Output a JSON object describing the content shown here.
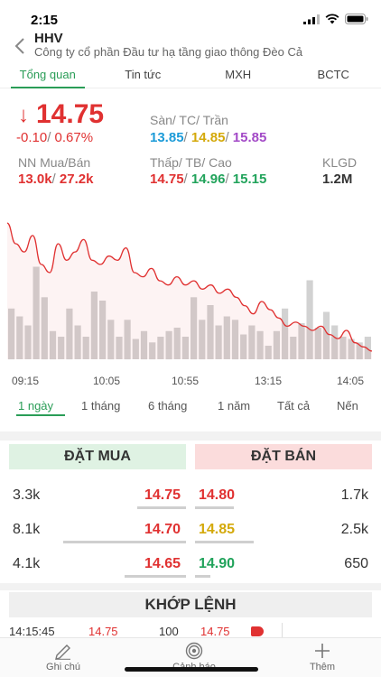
{
  "status_bar": {
    "time": "2:15"
  },
  "header": {
    "ticker": "HHV",
    "company": "Công ty cổ phần Đầu tư hạ tầng giao thông Đèo Cả"
  },
  "tabs": [
    {
      "label": "Tổng quan",
      "active": true
    },
    {
      "label": "Tin tức",
      "active": false
    },
    {
      "label": "MXH",
      "active": false
    },
    {
      "label": "BCTC",
      "active": false
    }
  ],
  "quote": {
    "price": "14.75",
    "change": "-0.10",
    "change_pct": "0.67%",
    "floor_ref_ceil_label": "Sàn/ TC/ Trần",
    "floor": "13.85",
    "ref": "14.85",
    "ceil": "15.85",
    "foreign_label": "NN Mua/Bán",
    "foreign_buy": "13.0k",
    "foreign_sell": "27.2k",
    "low_avg_high_label": "Thấp/ TB/ Cao",
    "low": "14.75",
    "avg": "14.96",
    "high": "15.15",
    "volume_label": "KLGD",
    "volume": "1.2M"
  },
  "chart_data": {
    "type": "line",
    "x_ticks": [
      "09:15",
      "10:05",
      "10:55",
      "13:15",
      "14:05"
    ],
    "price_line": [
      15.05,
      15.0,
      14.98,
      15.02,
      14.95,
      14.93,
      15.0,
      14.96,
      14.98,
      15.01,
      14.96,
      14.95,
      14.97,
      14.96,
      14.99,
      14.93,
      14.92,
      14.94,
      14.91,
      14.9,
      14.92,
      14.9,
      14.91,
      14.89,
      14.9,
      14.88,
      14.89,
      14.87,
      14.85,
      14.83,
      14.86,
      14.84,
      14.82,
      14.8,
      14.81,
      14.8,
      14.79,
      14.8,
      14.78,
      14.77,
      14.79,
      14.76,
      14.75,
      14.74
    ],
    "volume_bars": [
      0.45,
      0.38,
      0.3,
      0.82,
      0.55,
      0.25,
      0.2,
      0.45,
      0.3,
      0.2,
      0.6,
      0.52,
      0.35,
      0.2,
      0.35,
      0.18,
      0.25,
      0.15,
      0.2,
      0.25,
      0.28,
      0.2,
      0.55,
      0.35,
      0.48,
      0.3,
      0.38,
      0.35,
      0.22,
      0.3,
      0.25,
      0.12,
      0.25,
      0.45,
      0.2,
      0.32,
      0.7,
      0.28,
      0.42,
      0.3,
      0.2,
      0.18,
      0.15,
      0.2
    ],
    "grid": false
  },
  "ranges": [
    {
      "label": "1 ngày",
      "active": true
    },
    {
      "label": "1 tháng",
      "active": false
    },
    {
      "label": "6 tháng",
      "active": false
    },
    {
      "label": "1 năm",
      "active": false
    },
    {
      "label": "Tất cả",
      "active": false
    },
    {
      "label": "Nến",
      "active": false
    }
  ],
  "order_book": {
    "buy_label": "ĐẶT MUA",
    "sell_label": "ĐẶT BÁN",
    "rows": [
      {
        "buy_vol": "3.3k",
        "buy_price": "14.75",
        "sell_price": "14.80",
        "sell_vol": "1.7k",
        "buy_color": "#e03131",
        "sell_color": "#e03131",
        "buy_bar": 0.32,
        "sell_bar": 0.25
      },
      {
        "buy_vol": "8.1k",
        "buy_price": "14.70",
        "sell_price": "14.85",
        "sell_vol": "2.5k",
        "buy_color": "#e03131",
        "sell_color": "#d4a90a",
        "buy_bar": 0.8,
        "sell_bar": 0.38
      },
      {
        "buy_vol": "4.1k",
        "buy_price": "14.65",
        "sell_price": "14.90",
        "sell_vol": "650",
        "buy_color": "#e03131",
        "sell_color": "#21a35b",
        "buy_bar": 0.4,
        "sell_bar": 0.1
      }
    ]
  },
  "matched": {
    "title": "KHỚP LỆNH",
    "rows": [
      {
        "time": "14:15:45",
        "price": "14.75",
        "volume": "100",
        "price2": "14.75"
      }
    ]
  },
  "bottom_nav": [
    {
      "label": "Ghi chú",
      "icon": "pencil-icon"
    },
    {
      "label": "Cảnh báo",
      "icon": "target-icon"
    },
    {
      "label": "Thêm",
      "icon": "plus-icon"
    }
  ],
  "colors": {
    "red": "#e03131",
    "green": "#21a35b",
    "yellow": "#d4a90a",
    "blue": "#1c9bd8",
    "purple": "#a34ac7",
    "accent": "#2a9d57"
  }
}
